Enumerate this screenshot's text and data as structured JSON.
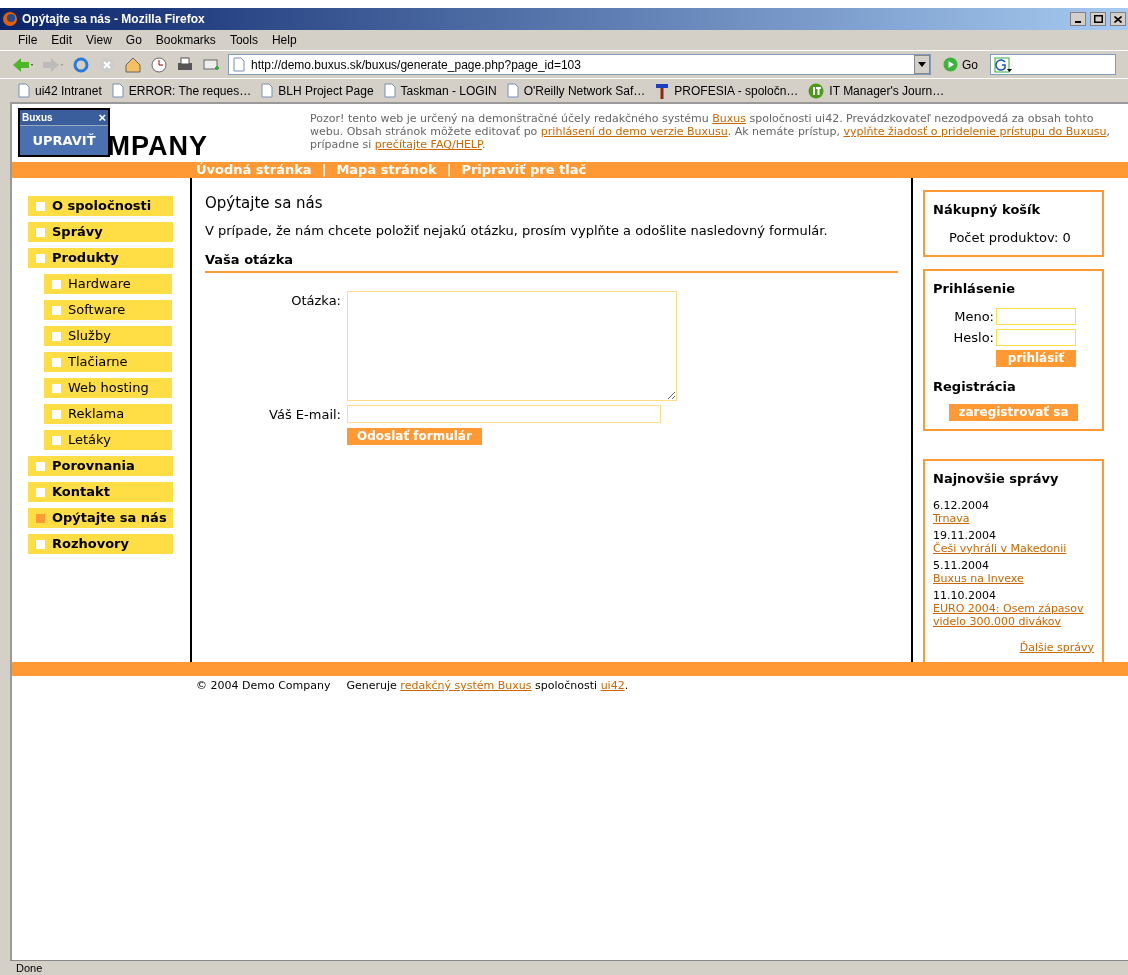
{
  "window": {
    "title": "Opýtajte sa nás - Mozilla Firefox"
  },
  "menu": [
    "File",
    "Edit",
    "View",
    "Go",
    "Bookmarks",
    "Tools",
    "Help"
  ],
  "address": {
    "value": "http://demo.buxus.sk/buxus/generate_page.php?page_id=103"
  },
  "go_label": "Go",
  "bookmarks": [
    {
      "label": "ui42 Intranet",
      "kind": "page"
    },
    {
      "label": "ERROR: The reques…",
      "kind": "page"
    },
    {
      "label": "BLH Project Page",
      "kind": "page"
    },
    {
      "label": "Taskman - LOGIN",
      "kind": "page"
    },
    {
      "label": "O'Reilly Network Saf…",
      "kind": "page"
    },
    {
      "label": "PROFESIA - spoločn…",
      "kind": "hammer"
    },
    {
      "label": "IT Manager's Journ…",
      "kind": "badge"
    }
  ],
  "editor_popup": {
    "title": "Buxus",
    "close": "×",
    "button": "UPRAVIŤ"
  },
  "logo": "MPANY",
  "notice": [
    {
      "text": "Pozor! tento web je určený na demonštračné účely redakčného systému ",
      "link": false
    },
    {
      "text": "Buxus",
      "link": true
    },
    {
      "text": " spoločnosti ui42. Prevádzkovateľ nezodpovedá za obsah tohto webu. Obsah stránok môžete editovať po ",
      "link": false
    },
    {
      "text": "prihlásení do demo verzie Buxusu",
      "link": true
    },
    {
      "text": ". Ak nemáte prístup, ",
      "link": false
    },
    {
      "text": "vyplňte žiadosť o pridelenie prístupu do Buxusu",
      "link": true
    },
    {
      "text": ", prípadne si ",
      "link": false
    },
    {
      "text": "prečítajte FAQ/HELP",
      "link": true
    },
    {
      "text": ".",
      "link": false
    }
  ],
  "top_nav": [
    "Úvodná stránka",
    "Mapa stránok",
    "Pripraviť pre tlač"
  ],
  "top_nav_separator": "|",
  "sidebar": {
    "items": [
      {
        "label": "O spoločnosti",
        "selected": false
      },
      {
        "label": "Správy",
        "selected": false
      },
      {
        "label": "Produkty",
        "selected": false,
        "children": [
          {
            "label": "Hardware",
            "selected": false
          },
          {
            "label": "Software",
            "selected": false
          },
          {
            "label": "Služby",
            "selected": false
          },
          {
            "label": "Tlačiarne",
            "selected": false
          },
          {
            "label": "Web hosting",
            "selected": false
          },
          {
            "label": "Reklama",
            "selected": false
          },
          {
            "label": "Letáky",
            "selected": false
          }
        ]
      },
      {
        "label": "Porovnania",
        "selected": false
      },
      {
        "label": "Kontakt",
        "selected": false
      },
      {
        "label": "Opýtajte sa nás",
        "selected": true
      },
      {
        "label": "Rozhovory",
        "selected": false
      }
    ]
  },
  "main": {
    "title": "Opýtajte sa nás",
    "intro": "V prípade, že nám chcete položiť nejakú otázku, prosím vyplňte a odošlite nasledovný formulár.",
    "section": "Vaša otázka",
    "question_label": "Otázka:",
    "email_label": "Váš E-mail:",
    "submit": "Odoslať formulár"
  },
  "cart": {
    "title": "Nákupný košík",
    "count": "Počet produktov: 0"
  },
  "login": {
    "title": "Prihlásenie",
    "name_label": "Meno:",
    "password_label": "Heslo:",
    "button": "prihlásiť",
    "register_title": "Registrácia",
    "register_button": "zaregistrovať sa"
  },
  "news": {
    "title": "Najnovšie správy",
    "items": [
      {
        "date": "6.12.2004",
        "title": "Trnava"
      },
      {
        "date": "19.11.2004",
        "title": "Češi vyhráli v Makedonii"
      },
      {
        "date": "5.11.2004",
        "title": "Buxus na Invexe"
      },
      {
        "date": "11.10.2004",
        "title": "EURO 2004: Osem zápasov videlo 300.000 divákov"
      }
    ],
    "more": "Ďalšie správy"
  },
  "footer": {
    "copyright": "© 2004 Demo Company",
    "generated": "Generuje",
    "link": "redakčný systém Buxus",
    "middle": "spoločnosti",
    "link2": "ui42",
    "end": "."
  },
  "status_bar": "Done"
}
